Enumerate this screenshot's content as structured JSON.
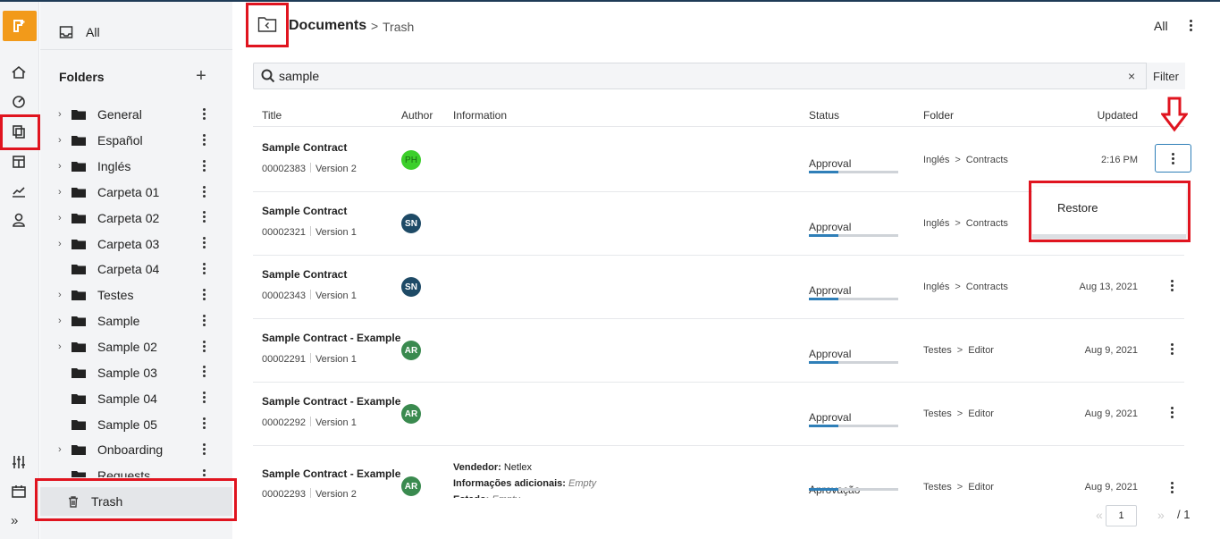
{
  "folders_panel": {
    "all_label": "All",
    "heading": "Folders",
    "items": [
      {
        "name": "General",
        "expandable": true
      },
      {
        "name": "Español",
        "expandable": true
      },
      {
        "name": "Inglés",
        "expandable": true
      },
      {
        "name": "Carpeta 01",
        "expandable": true
      },
      {
        "name": "Carpeta 02",
        "expandable": true
      },
      {
        "name": "Carpeta 03",
        "expandable": true
      },
      {
        "name": "Carpeta 04",
        "expandable": false
      },
      {
        "name": "Testes",
        "expandable": true
      },
      {
        "name": "Sample",
        "expandable": true
      },
      {
        "name": "Sample 02",
        "expandable": true
      },
      {
        "name": "Sample 03",
        "expandable": false
      },
      {
        "name": "Sample 04",
        "expandable": false
      },
      {
        "name": "Sample 05",
        "expandable": false
      },
      {
        "name": "Onboarding",
        "expandable": true
      },
      {
        "name": "Requests",
        "expandable": false
      }
    ],
    "trash_label": "Trash"
  },
  "header": {
    "breadcrumb_root": "Documents",
    "breadcrumb_sep": ">",
    "breadcrumb_current": "Trash",
    "view_label": "All"
  },
  "search": {
    "value": "sample",
    "clear_label": "×",
    "filter_label": "Filter"
  },
  "table": {
    "columns": {
      "title": "Title",
      "author": "Author",
      "information": "Information",
      "status": "Status",
      "folder": "Folder",
      "updated": "Updated"
    },
    "rows": [
      {
        "title": "Sample Contract",
        "number": "00002383",
        "version": "Version 2",
        "author": "PH",
        "author_color": "#3ccf2b",
        "status": "Approval",
        "progress": 0.33,
        "folder_parent": "Inglés",
        "folder_child": "Contracts",
        "updated": "2:16 PM"
      },
      {
        "title": "Sample Contract",
        "number": "00002321",
        "version": "Version 1",
        "author": "SN",
        "author_color": "#1e4a66",
        "status": "Approval",
        "progress": 0.33,
        "folder_parent": "Inglés",
        "folder_child": "Contracts",
        "updated": ""
      },
      {
        "title": "Sample Contract",
        "number": "00002343",
        "version": "Version 1",
        "author": "SN",
        "author_color": "#1e4a66",
        "status": "Approval",
        "progress": 0.33,
        "folder_parent": "Inglés",
        "folder_child": "Contracts",
        "updated": "Aug 13, 2021"
      },
      {
        "title": "Sample Contract - Example",
        "number": "00002291",
        "version": "Version 1",
        "author": "AR",
        "author_color": "#3a8a4f",
        "status": "Approval",
        "progress": 0.33,
        "folder_parent": "Testes",
        "folder_child": "Editor",
        "updated": "Aug 9, 2021"
      },
      {
        "title": "Sample Contract - Example",
        "number": "00002292",
        "version": "Version 1",
        "author": "AR",
        "author_color": "#3a8a4f",
        "status": "Approval",
        "progress": 0.33,
        "folder_parent": "Testes",
        "folder_child": "Editor",
        "updated": "Aug 9, 2021"
      },
      {
        "title": "Sample Contract - Example",
        "number": "00002293",
        "version": "Version 2",
        "author": "AR",
        "author_color": "#3a8a4f",
        "status": "Aprovação",
        "progress": 0.33,
        "folder_parent": "Testes",
        "folder_child": "Editor",
        "updated": "Aug 9, 2021",
        "info": [
          {
            "label": "Vendedor:",
            "value": "Netlex",
            "empty": false
          },
          {
            "label": "Informações adicionais:",
            "value": "Empty",
            "empty": true
          },
          {
            "label": "Estado:",
            "value": "Empty",
            "empty": true
          }
        ]
      }
    ]
  },
  "context_menu": {
    "restore_label": "Restore"
  },
  "pager": {
    "current": "1",
    "total": "/ 1"
  },
  "colors": {
    "brand": "#f29a1a",
    "accent": "#2f7fb8",
    "annotation": "#e0141f"
  }
}
